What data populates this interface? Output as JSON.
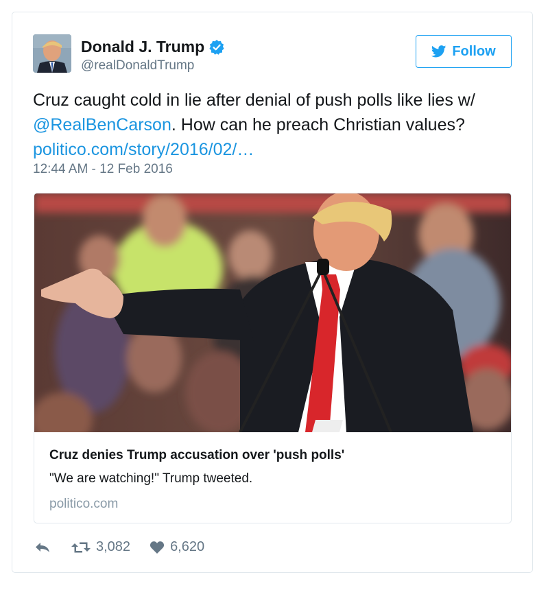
{
  "author": {
    "name": "Donald J. Trump",
    "handle": "@realDonaldTrump",
    "verified": true
  },
  "follow_button": {
    "label": "Follow",
    "icon": "twitter-bird-icon"
  },
  "tweet": {
    "text_part1": "Cruz caught cold in lie after denial of push polls like lies w/",
    "mention": "@RealBenCarson",
    "text_part2": ". How can he preach Christian values?",
    "link": "politico.com/story/2016/02/…",
    "timestamp": "12:44 AM - 12 Feb 2016"
  },
  "link_card": {
    "title": "Cruz denies Trump accusation over 'push polls'",
    "description": "\"We are watching!\" Trump tweeted.",
    "domain": "politico.com"
  },
  "actions": {
    "reply_icon": "reply-icon",
    "retweet_icon": "retweet-icon",
    "retweet_count": "3,082",
    "like_icon": "heart-icon",
    "like_count": "6,620"
  },
  "colors": {
    "link_blue": "#1b95e0",
    "brand_blue": "#1da1f2",
    "muted_gray": "#657786",
    "text_dark": "#14171a"
  }
}
